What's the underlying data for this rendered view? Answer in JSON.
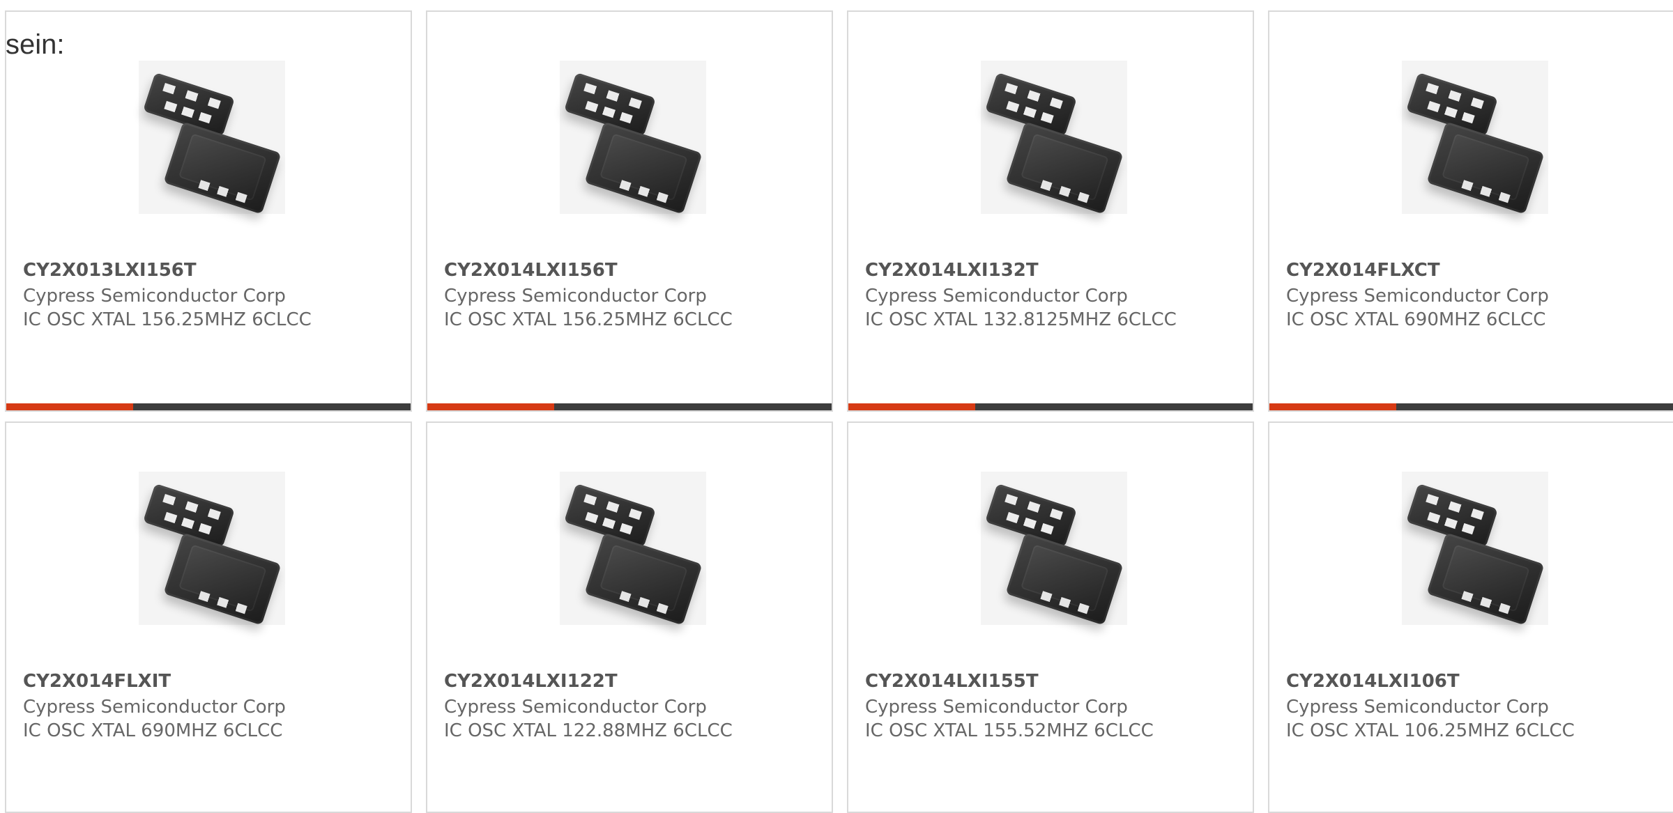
{
  "intro_text": "sein:",
  "cards": [
    {
      "part_number": "CY2X013LXI156T",
      "manufacturer": "Cypress Semiconductor Corp",
      "description": "IC OSC XTAL 156.25MHZ 6CLCC"
    },
    {
      "part_number": "CY2X014LXI156T",
      "manufacturer": "Cypress Semiconductor Corp",
      "description": "IC OSC XTAL 156.25MHZ 6CLCC"
    },
    {
      "part_number": "CY2X014LXI132T",
      "manufacturer": "Cypress Semiconductor Corp",
      "description": "IC OSC XTAL 132.8125MHZ 6CLCC"
    },
    {
      "part_number": "CY2X014FLXCT",
      "manufacturer": "Cypress Semiconductor Corp",
      "description": "IC OSC XTAL 690MHZ 6CLCC"
    },
    {
      "part_number": "CY2X014FLXIT",
      "manufacturer": "Cypress Semiconductor Corp",
      "description": "IC OSC XTAL 690MHZ 6CLCC"
    },
    {
      "part_number": "CY2X014LXI122T",
      "manufacturer": "Cypress Semiconductor Corp",
      "description": "IC OSC XTAL 122.88MHZ 6CLCC"
    },
    {
      "part_number": "CY2X014LXI155T",
      "manufacturer": "Cypress Semiconductor Corp",
      "description": "IC OSC XTAL 155.52MHZ 6CLCC"
    },
    {
      "part_number": "CY2X014LXI106T",
      "manufacturer": "Cypress Semiconductor Corp",
      "description": "IC OSC XTAL 106.25MHZ 6CLCC"
    }
  ]
}
